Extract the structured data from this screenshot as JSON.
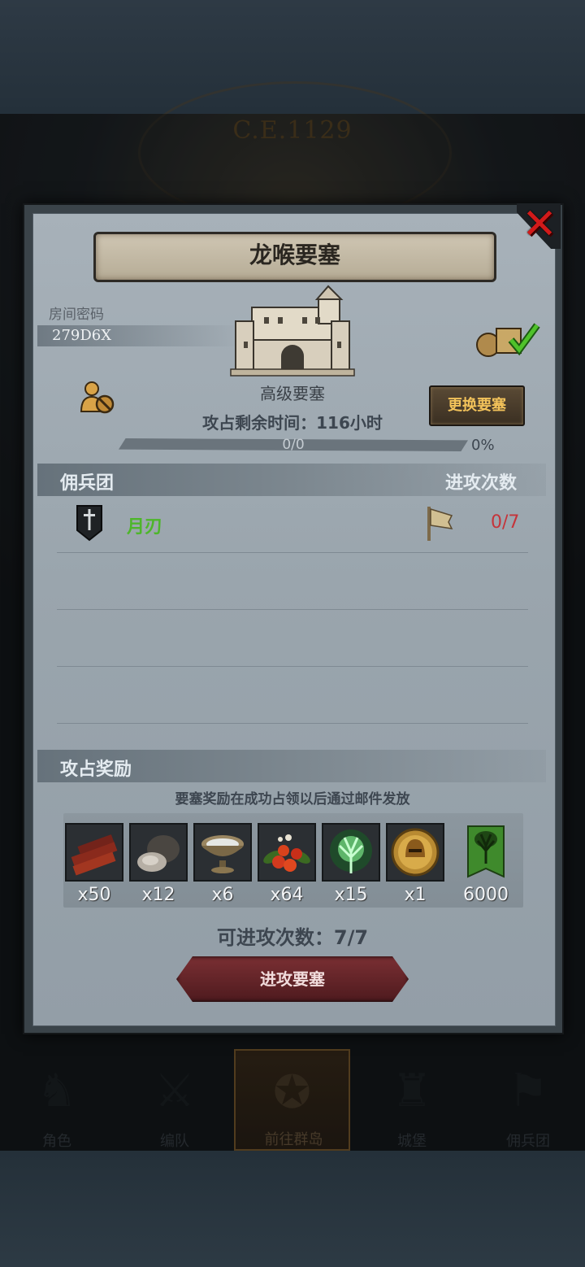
{
  "background": {
    "era_label": "C.E.1129"
  },
  "dialog": {
    "title": "龙喉要塞",
    "room": {
      "label": "房间密码",
      "code": "279D6X"
    },
    "fortress": {
      "type": "高级要塞",
      "icon": "castle-icon"
    },
    "change_button": "更换要塞",
    "time_left": "攻占剩余时间：116小时",
    "progress": {
      "value_text": "0/0",
      "percent_text": "0%",
      "fraction": 0
    },
    "mercenary_header": "佣兵团",
    "attack_header": "进攻次数",
    "guilds": [
      {
        "name": "月刃",
        "attacks": "0/7",
        "icon": "dagger-shield-icon"
      }
    ],
    "rewards_header": "攻占奖励",
    "rewards_note": "要塞奖励在成功占领以后通过邮件发放",
    "rewards": [
      {
        "icon": "wood-planks-icon",
        "qty": "x50"
      },
      {
        "icon": "ore-rock-icon",
        "qty": "x12"
      },
      {
        "icon": "bowl-icon",
        "qty": "x6"
      },
      {
        "icon": "berries-icon",
        "qty": "x64"
      },
      {
        "icon": "green-tree-essence-icon",
        "qty": "x15"
      },
      {
        "icon": "golden-helmet-coin-icon",
        "qty": "x1"
      },
      {
        "icon": "green-banner-icon",
        "qty": "6000"
      }
    ],
    "attempts_text": "可进攻次数：7/7",
    "attack_button": "进攻要塞"
  },
  "bottom_nav": [
    {
      "label": "角色",
      "icon": "knight-icon"
    },
    {
      "label": "编队",
      "icon": "formation-icon"
    },
    {
      "label": "前往群岛",
      "icon": "compass-icon"
    },
    {
      "label": "城堡",
      "icon": "castle-icon"
    },
    {
      "label": "佣兵团",
      "icon": "banner-icon"
    }
  ],
  "colors": {
    "guild_name": "#4eb62b",
    "attack_count": "#c5343a",
    "close": "#d11a1a",
    "change_button_text": "#f2c25a"
  }
}
